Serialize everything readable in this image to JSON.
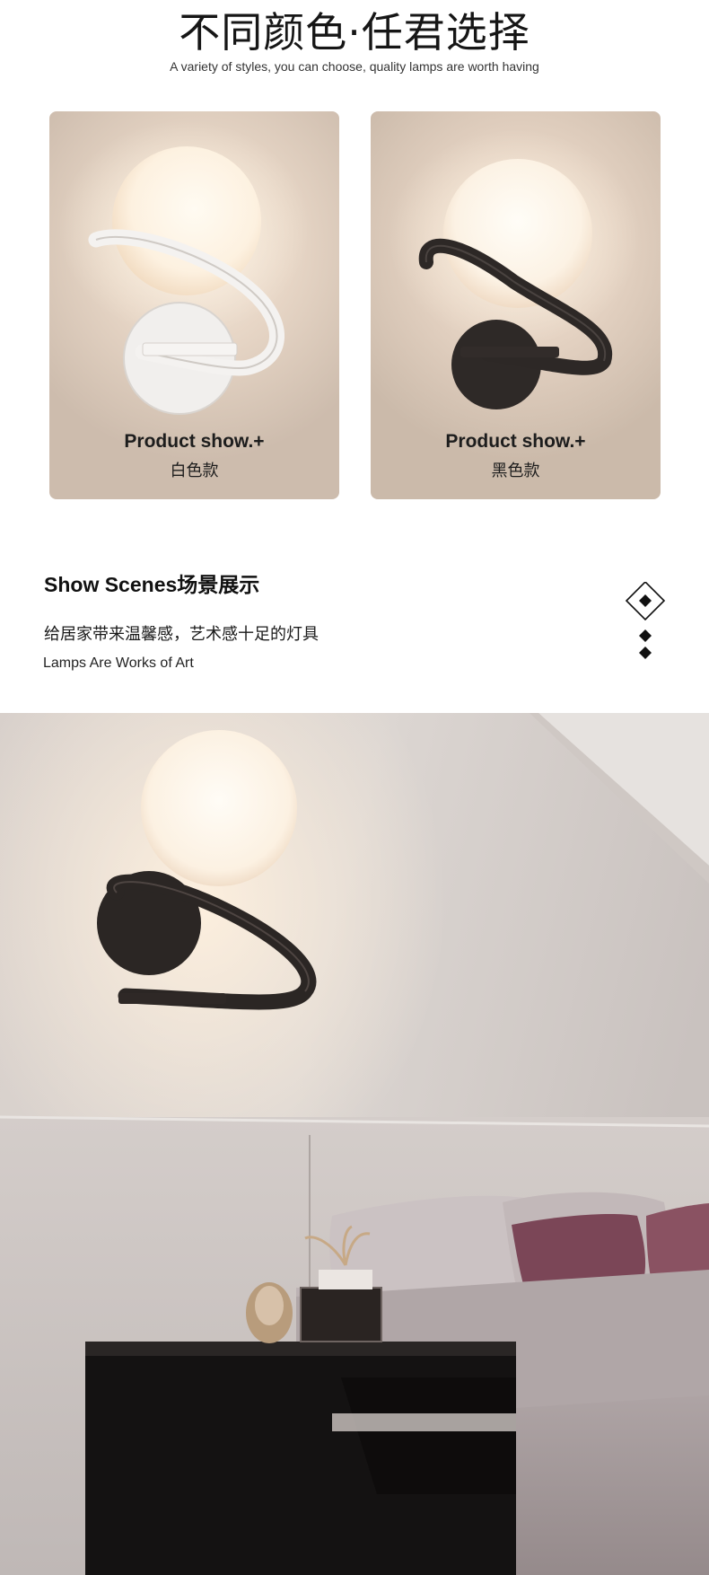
{
  "header": {
    "title": "不同颜色·任君选择",
    "subtitle": "A variety of styles, you can choose, quality lamps are worth having"
  },
  "products": [
    {
      "caption_en": "Product show.+",
      "caption_cn": "白色款",
      "finish": "white"
    },
    {
      "caption_en": "Product show.+",
      "caption_cn": "黑色款",
      "finish": "black"
    }
  ],
  "scenes": {
    "title": "Show Scenes场景展示",
    "tagline_cn": "给居家带来温馨感，艺术感十足的灯具",
    "tagline_en": "Lamps Are Works of Art"
  },
  "colors": {
    "card_bg": "#e7d6c6",
    "white_finish": "#f2f0ee",
    "black_finish": "#2b2624",
    "glass_globe": "#fff8ee",
    "wall": "#ddd7d2",
    "pillow_accent": "#7b4657"
  }
}
